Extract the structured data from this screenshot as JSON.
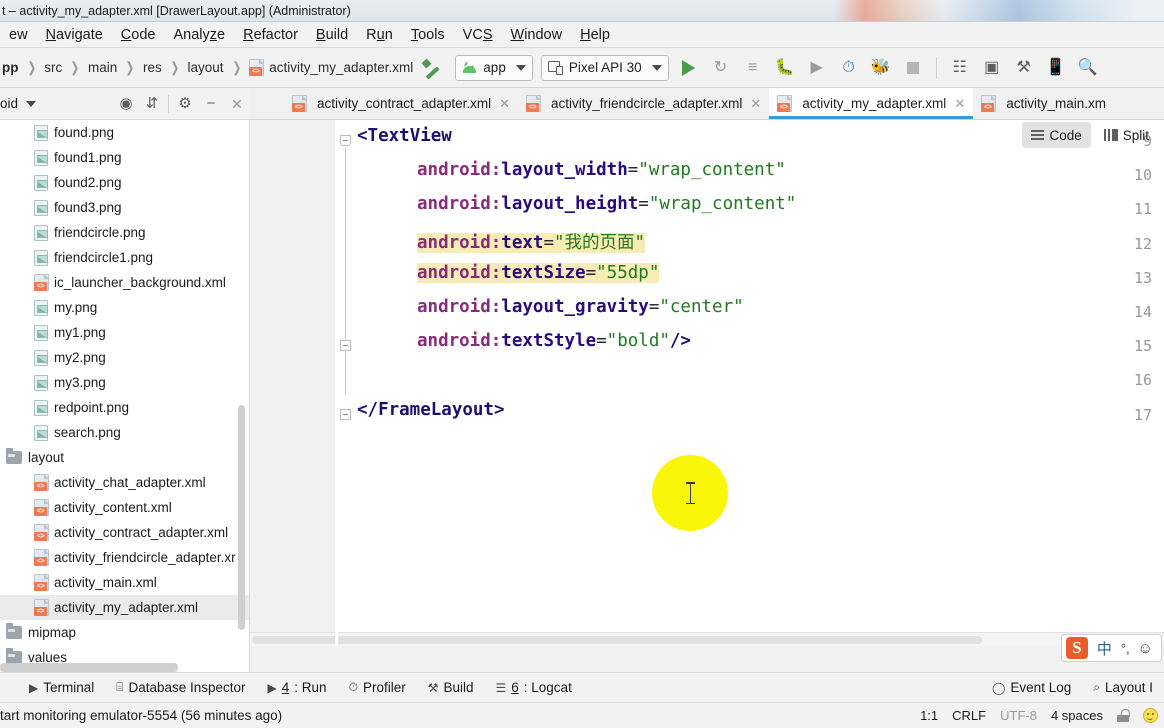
{
  "window": {
    "title": "t – activity_my_adapter.xml [DrawerLayout.app] (Administrator)"
  },
  "menubar": {
    "items": [
      {
        "label": "ew",
        "mnemonic": ""
      },
      {
        "label": "Navigate",
        "mnemonic": "N"
      },
      {
        "label": "Code",
        "mnemonic": "C"
      },
      {
        "label": "Analyze",
        "mnemonic": "z"
      },
      {
        "label": "Refactor",
        "mnemonic": "R"
      },
      {
        "label": "Build",
        "mnemonic": "B"
      },
      {
        "label": "Run",
        "mnemonic": "u"
      },
      {
        "label": "Tools",
        "mnemonic": "T"
      },
      {
        "label": "VCS",
        "mnemonic": "S"
      },
      {
        "label": "Window",
        "mnemonic": "W"
      },
      {
        "label": "Help",
        "mnemonic": "H"
      }
    ]
  },
  "toolbar": {
    "breadcrumb": [
      "pp",
      "src",
      "main",
      "res",
      "layout",
      "activity_my_adapter.xml"
    ],
    "build_variant": "app",
    "device": "Pixel API 30",
    "icons": [
      "run-icon",
      "rerun-icon",
      "apply-changes-icon",
      "debug-icon",
      "attach-debugger-icon",
      "profiler-icon",
      "run-with-coverage-icon",
      "stop-icon",
      "sdk-manager-icon",
      "avd-manager-icon",
      "layout-inspector-icon",
      "device-file-explorer-icon",
      "search-icon"
    ]
  },
  "project_panel": {
    "title": "oid",
    "icons": [
      "locate-icon",
      "collapse-all-icon",
      "settings-gear-icon",
      "hide-icon",
      "close-icon"
    ],
    "tree": [
      {
        "name": "found.png",
        "type": "png",
        "indent": 2,
        "selected": false
      },
      {
        "name": "found1.png",
        "type": "png",
        "indent": 2,
        "selected": false
      },
      {
        "name": "found2.png",
        "type": "png",
        "indent": 2,
        "selected": false
      },
      {
        "name": "found3.png",
        "type": "png",
        "indent": 2,
        "selected": false
      },
      {
        "name": "friendcircle.png",
        "type": "png",
        "indent": 2,
        "selected": false
      },
      {
        "name": "friendcircle1.png",
        "type": "png",
        "indent": 2,
        "selected": false
      },
      {
        "name": "ic_launcher_background.xml",
        "type": "xml",
        "indent": 2,
        "selected": false
      },
      {
        "name": "my.png",
        "type": "png",
        "indent": 2,
        "selected": false
      },
      {
        "name": "my1.png",
        "type": "png",
        "indent": 2,
        "selected": false
      },
      {
        "name": "my2.png",
        "type": "png",
        "indent": 2,
        "selected": false
      },
      {
        "name": "my3.png",
        "type": "png",
        "indent": 2,
        "selected": false
      },
      {
        "name": "redpoint.png",
        "type": "png",
        "indent": 2,
        "selected": false
      },
      {
        "name": "search.png",
        "type": "png",
        "indent": 2,
        "selected": false
      },
      {
        "name": "layout",
        "type": "folder",
        "indent": 0,
        "selected": false
      },
      {
        "name": "activity_chat_adapter.xml",
        "type": "xml",
        "indent": 2,
        "selected": false
      },
      {
        "name": "activity_content.xml",
        "type": "xml",
        "indent": 2,
        "selected": false
      },
      {
        "name": "activity_contract_adapter.xml",
        "type": "xml",
        "indent": 2,
        "selected": false
      },
      {
        "name": "activity_friendcircle_adapter.xr",
        "type": "xml",
        "indent": 2,
        "selected": false
      },
      {
        "name": "activity_main.xml",
        "type": "xml",
        "indent": 2,
        "selected": false
      },
      {
        "name": "activity_my_adapter.xml",
        "type": "xml",
        "indent": 2,
        "selected": true
      },
      {
        "name": "mipmap",
        "type": "folder",
        "indent": 0,
        "selected": false
      },
      {
        "name": "values",
        "type": "folder",
        "indent": 0,
        "selected": false
      }
    ]
  },
  "editor_tabs": [
    {
      "label": "activity_contract_adapter.xml",
      "active": false,
      "closable": true
    },
    {
      "label": "activity_friendcircle_adapter.xml",
      "active": false,
      "closable": true
    },
    {
      "label": "activity_my_adapter.xml",
      "active": true,
      "closable": true
    },
    {
      "label": "activity_main.xm",
      "active": false,
      "closable": false
    }
  ],
  "view_toggle": {
    "code_label": "Code",
    "split_label": "Split",
    "selected": "Code"
  },
  "editor": {
    "lines": [
      {
        "no": "9",
        "indent": 0,
        "parts": [
          {
            "t": "punct",
            "s": "<"
          },
          {
            "t": "tagname",
            "s": "TextView"
          }
        ],
        "highlight": false,
        "fold": "open"
      },
      {
        "no": "10",
        "indent": 4,
        "parts": [
          {
            "t": "attrpfx",
            "s": "android:"
          },
          {
            "t": "attr",
            "s": "layout_width"
          },
          {
            "t": "eq",
            "s": "="
          },
          {
            "t": "val",
            "s": "\"wrap_content\""
          }
        ],
        "highlight": false,
        "fold": ""
      },
      {
        "no": "11",
        "indent": 4,
        "parts": [
          {
            "t": "attrpfx",
            "s": "android:"
          },
          {
            "t": "attr",
            "s": "layout_height"
          },
          {
            "t": "eq",
            "s": "="
          },
          {
            "t": "val",
            "s": "\"wrap_content\""
          }
        ],
        "highlight": false,
        "fold": ""
      },
      {
        "no": "12",
        "indent": 4,
        "parts": [
          {
            "t": "attrpfx",
            "s": "android:"
          },
          {
            "t": "attr",
            "s": "text"
          },
          {
            "t": "eq",
            "s": "="
          },
          {
            "t": "val",
            "s": "\"我的页面\""
          }
        ],
        "highlight": true,
        "fold": ""
      },
      {
        "no": "13",
        "indent": 4,
        "parts": [
          {
            "t": "attrpfx",
            "s": "android:"
          },
          {
            "t": "attr",
            "s": "textSize"
          },
          {
            "t": "eq",
            "s": "="
          },
          {
            "t": "val",
            "s": "\"55dp\""
          }
        ],
        "highlight": true,
        "fold": ""
      },
      {
        "no": "14",
        "indent": 4,
        "parts": [
          {
            "t": "attrpfx",
            "s": "android:"
          },
          {
            "t": "attr",
            "s": "layout_gravity"
          },
          {
            "t": "eq",
            "s": "="
          },
          {
            "t": "val",
            "s": "\"center\""
          }
        ],
        "highlight": false,
        "fold": ""
      },
      {
        "no": "15",
        "indent": 4,
        "parts": [
          {
            "t": "attrpfx",
            "s": "android:"
          },
          {
            "t": "attr",
            "s": "textStyle"
          },
          {
            "t": "eq",
            "s": "="
          },
          {
            "t": "val",
            "s": "\"bold\""
          },
          {
            "t": "punct",
            "s": "/>"
          }
        ],
        "highlight": false,
        "fold": "close"
      },
      {
        "no": "16",
        "indent": 0,
        "parts": [],
        "highlight": false,
        "fold": ""
      },
      {
        "no": "17",
        "indent": 0,
        "parts": [
          {
            "t": "punct",
            "s": "</FrameLayout>"
          }
        ],
        "highlight": false,
        "fold": "close"
      }
    ]
  },
  "ime": {
    "logo": "S",
    "mode": "中",
    "punctuation": "°,",
    "emoji": "☺"
  },
  "tool_windows": [
    {
      "label": "Terminal",
      "icon": "terminal-icon",
      "number": ""
    },
    {
      "label": "Database Inspector",
      "icon": "database-icon",
      "number": ""
    },
    {
      "label": ": Run",
      "icon": "run-icon",
      "number": "4"
    },
    {
      "label": "Profiler",
      "icon": "profiler-icon",
      "number": ""
    },
    {
      "label": "Build",
      "icon": "hammer-icon",
      "number": ""
    },
    {
      "label": ": Logcat",
      "icon": "logcat-icon",
      "number": "6"
    }
  ],
  "tool_windows_right": [
    {
      "label": "Event Log",
      "icon": "event-log-icon"
    },
    {
      "label": "Layout I",
      "icon": "layout-inspector-icon"
    }
  ],
  "statusbar": {
    "message": "tart monitoring emulator-5554 (56 minutes ago)",
    "caret": "1:1",
    "line_separator": "CRLF",
    "encoding": "UTF-8",
    "indent": "4 spaces",
    "lock": "lock-icon",
    "face": "smiley-icon"
  },
  "colors": {
    "accent_blue": "#3a9ad9",
    "highlight_yellow": "#f7ecb5",
    "click_yellow": "#f9f60a",
    "attr_purple": "#2b0a7e",
    "value_green": "#1f7a1f",
    "xml_icon_orange": "#ef7a52",
    "run_green": "#499b4e"
  }
}
